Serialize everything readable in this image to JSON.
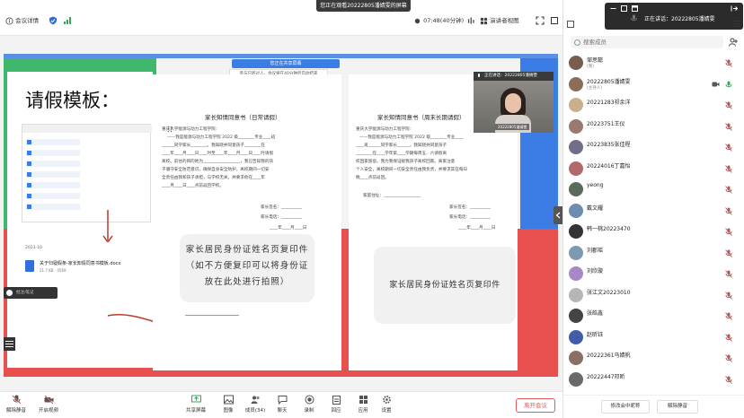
{
  "topbar": {
    "banner": "您正在观看20222805潘婧雯的屏幕",
    "meeting_detail": "会议详情",
    "timer": "07:48(40分钟)",
    "view_mode": "演讲者视图",
    "member_badge": "成员(34)"
  },
  "shared": {
    "share_tip": "您正在共享屏幕",
    "share_tip_sub": "参与已超过人，会议将在40分钟后自动结束",
    "slide_title": "请假模板：",
    "file_date": "2023-10",
    "file_name": "关于归寝假条-家长知情同意书模板.docx",
    "file_size": "21.7 KB · 4569",
    "annotation_label": "批注/笔记",
    "video_head": "正在讲话：20222805潘婧雯",
    "video_name": "20222805潘婧雯"
  },
  "doc_left": {
    "title": "家长知情同意书（日常请假）",
    "lines": [
      "重庆大学能源与动力工程学院：",
      "——我是能源与动力工程学院 2022 级________专业____班",
      "______同学家长________。我知晓并同意孩子________在",
      "____年____月____日____时至____年____月____日____时请假",
      "离校。前往的目的地为__________________，我已告知我的孩",
      "子遵守安全防范意识，确保自身安全防护，离校期间一切安",
      "全责任由我和孩子承担，与学校无关。并要求他在____年",
      "____月____日____点前返回学校。",
      "家长签名：__________",
      "家长电话：__________",
      "____年____月____日"
    ],
    "id_card": "家长居民身份证姓名页复印件（如不方便复印可以将身份证放在此处进行拍照）"
  },
  "doc_right": {
    "title": "家长知情同意书（周末长期请假）",
    "lines": [
      "重庆大学能源与动力工程学院：",
      "——我是能源与动力工程学院 2022 级________专业____",
      "____班______同学家长______，我知晓并同意孩子",
      "________在____学年第____学期每周五、六请假离",
      "校回家留宿，我为我保证接我孩子离校回家。离家注意",
      "个人安全，离校期间一切安全责任由我负责，并要求其在每日",
      "晚____点前返回。",
      "家庭住址：__________________",
      "家长签名：__________",
      "家长电话：__________",
      "____年____月____日"
    ],
    "id_card": "家长居民身份证姓名页复印件"
  },
  "bottombar": {
    "unmute": "解除静音",
    "video": "开启视频",
    "share": "共享屏幕",
    "annotate": "图像",
    "members": "成员(34)",
    "chat": "聊天",
    "record": "录制",
    "apps": "应用",
    "settings": "设置",
    "leave": "离开会议"
  },
  "panel": {
    "speaking": "正在讲话：20222805潘婧雯",
    "search_placeholder": "搜索成员",
    "participants": [
      {
        "name": "邹思懿",
        "sub": "(我)",
        "color": "#7a5c4f"
      },
      {
        "name": "20222805潘婧雯",
        "sub": "(主持人)",
        "color": "#8a6d5b"
      },
      {
        "name": "20221283祁余洋",
        "sub": "",
        "color": "#c9b08a"
      },
      {
        "name": "20223751王仪",
        "sub": "",
        "color": "#9a7a6e"
      },
      {
        "name": "20223835张佳程",
        "sub": "",
        "color": "#6f6f8a"
      },
      {
        "name": "20224016丁嘉怡",
        "sub": "",
        "color": "#b06a6a"
      },
      {
        "name": "yeong",
        "sub": "",
        "color": "#5b6b5b"
      },
      {
        "name": "戴文耀",
        "sub": "",
        "color": "#6c8db0"
      },
      {
        "name": "韩一桃20223470",
        "sub": "",
        "color": "#333333"
      },
      {
        "name": "刘郡瑶",
        "sub": "",
        "color": "#7d9ab3"
      },
      {
        "name": "刘欣璇",
        "sub": "",
        "color": "#a888c9"
      },
      {
        "name": "张江文20223010",
        "sub": "",
        "color": "#b6b6b6"
      },
      {
        "name": "张皓鑫",
        "sub": "",
        "color": "#444444"
      },
      {
        "name": "赵昕钰",
        "sub": "",
        "color": "#3f5da8"
      },
      {
        "name": "20222361马婧帆",
        "sub": "",
        "color": "#8a7060"
      },
      {
        "name": "20222447邓昕",
        "sub": "",
        "color": "#6a6a6a"
      }
    ],
    "rename_button": "修改会中昵称",
    "unmute_all_button": "解除静音"
  }
}
